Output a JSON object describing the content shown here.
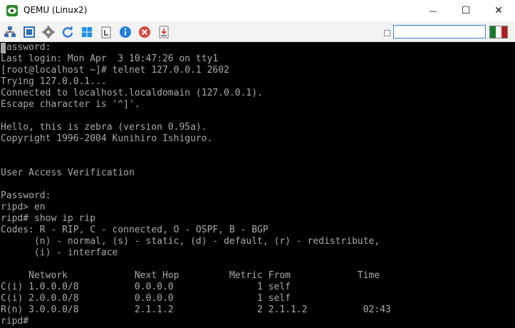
{
  "window": {
    "title": "QEMU (Linux2)",
    "minimize_glyph": "—",
    "maximize_glyph": "☐",
    "close_glyph": "✕"
  },
  "toolbar": {
    "search_value": "",
    "buttons": [
      "network-icon",
      "fullscreen-icon",
      "gear-icon",
      "refresh-icon",
      "windows-icon",
      "clipboard-icon",
      "info-icon",
      "stop-icon",
      "save-icon"
    ]
  },
  "terminal": {
    "lines": [
      "Password:",
      "Last login: Mon Apr  3 10:47:26 on tty1",
      "[root@localhost ~]# telnet 127.0.0.1 2602",
      "Trying 127.0.0.1...",
      "Connected to localhost.localdomain (127.0.0.1).",
      "Escape character is '^]'.",
      "",
      "Hello, this is zebra (version 0.95a).",
      "Copyright 1996-2004 Kunihiro Ishiguro.",
      "",
      "",
      "User Access Verification",
      "",
      "Password:",
      "ripd> en",
      "ripd# show ip rip",
      "Codes: R - RIP, C - connected, O - OSPF, B - BGP",
      "      (n) - normal, (s) - static, (d) - default, (r) - redistribute,",
      "      (i) - interface",
      "",
      "     Network            Next Hop         Metric From            Time",
      "C(i) 1.0.0.0/8          0.0.0.0               1 self",
      "C(i) 2.0.0.0/8          0.0.0.0               1 self",
      "R(n) 3.0.0.0/8          2.1.1.2               2 2.1.1.2          02:43",
      "ripd#"
    ]
  }
}
